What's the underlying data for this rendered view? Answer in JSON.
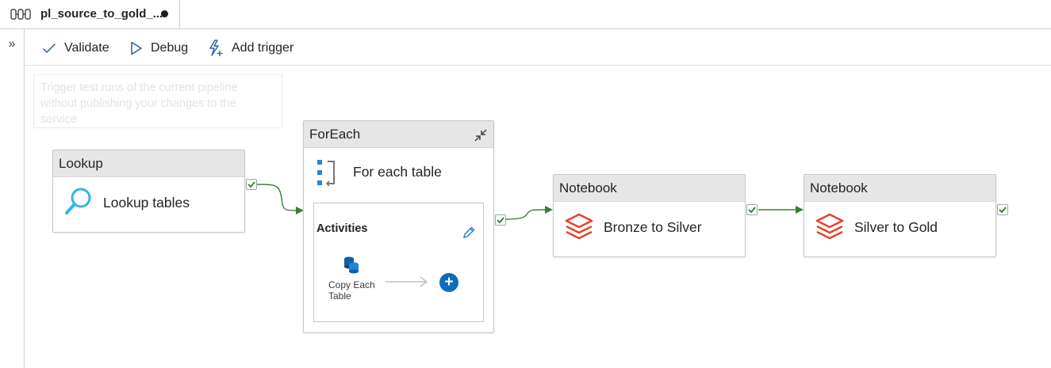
{
  "tab": {
    "title": "pl_source_to_gold_...",
    "icon": "pipeline-icon",
    "unsaved": true
  },
  "leftrail": {
    "expand_label": "»"
  },
  "toolbar": {
    "validate_label": "Validate",
    "debug_label": "Debug",
    "add_trigger_label": "Add trigger"
  },
  "tooltip": {
    "text": "Trigger test runs of the current pipeline without publishing your changes to the service"
  },
  "activities": {
    "lookup": {
      "type": "Lookup",
      "name": "Lookup tables",
      "icon": "lookup-icon"
    },
    "foreach": {
      "type": "ForEach",
      "name": "For each table",
      "icon": "foreach-icon",
      "inner_title": "Activities",
      "inner_activity": "Copy Each Table",
      "inner_activity_line1": "Copy Each",
      "inner_activity_line2": "Table"
    },
    "notebook1": {
      "type": "Notebook",
      "name": "Bronze to Silver",
      "icon": "databricks-icon"
    },
    "notebook2": {
      "type": "Notebook",
      "name": "Silver to Gold",
      "icon": "databricks-icon"
    }
  },
  "colors": {
    "success_green": "#3a7d3a",
    "accent_blue": "#0f6cbd",
    "databricks_red": "#e8422c",
    "lookup_cyan": "#30b7e4"
  }
}
